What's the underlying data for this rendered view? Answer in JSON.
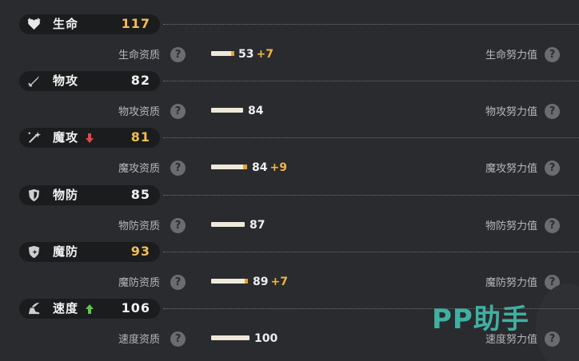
{
  "stats": [
    {
      "key": "hp",
      "icon": "heart-icon",
      "label": "生命",
      "value": "117",
      "value_color": "#f4bd52",
      "arrow": "none",
      "aptitude_label": "生命资质",
      "aptitude_base": "53",
      "aptitude_bonus": "+7",
      "aptitude_level": 0.53,
      "bonus_level": 0.07,
      "ev_label": "生命努力值"
    },
    {
      "key": "atk",
      "icon": "sword-icon",
      "label": "物攻",
      "value": "82",
      "value_color": "#f2f2f2",
      "arrow": "none",
      "aptitude_label": "物攻资质",
      "aptitude_base": "84",
      "aptitude_bonus": "",
      "aptitude_level": 0.84,
      "bonus_level": 0,
      "ev_label": "物攻努力值"
    },
    {
      "key": "matk",
      "icon": "magic-wand-icon",
      "label": "魔攻",
      "value": "81",
      "value_color": "#f4bd52",
      "arrow": "down",
      "aptitude_label": "魔攻资质",
      "aptitude_base": "84",
      "aptitude_bonus": "+9",
      "aptitude_level": 0.84,
      "bonus_level": 0.09,
      "ev_label": "魔攻努力值"
    },
    {
      "key": "def",
      "icon": "shield-icon",
      "label": "物防",
      "value": "85",
      "value_color": "#f2f2f2",
      "arrow": "none",
      "aptitude_label": "物防资质",
      "aptitude_base": "87",
      "aptitude_bonus": "",
      "aptitude_level": 0.87,
      "bonus_level": 0,
      "ev_label": "物防努力值"
    },
    {
      "key": "mdef",
      "icon": "magic-shield-icon",
      "label": "魔防",
      "value": "93",
      "value_color": "#f4bd52",
      "arrow": "none",
      "aptitude_label": "魔防资质",
      "aptitude_base": "89",
      "aptitude_bonus": "+7",
      "aptitude_level": 0.89,
      "bonus_level": 0.07,
      "ev_label": "魔防努力值"
    },
    {
      "key": "spd",
      "icon": "wing-boot-icon",
      "label": "速度",
      "value": "106",
      "value_color": "#f2f2f2",
      "arrow": "up",
      "aptitude_label": "速度资质",
      "aptitude_base": "100",
      "aptitude_bonus": "",
      "aptitude_level": 1.0,
      "bonus_level": 0,
      "ev_label": "速度努力值"
    }
  ],
  "help_glyph": "?",
  "watermark": "PP助手",
  "colors": {
    "highlight": "#f4bd52",
    "bonus": "#f2b543",
    "down_arrow": "#e04848",
    "up_arrow": "#5cc84a",
    "watermark": "#3fb0a2"
  }
}
